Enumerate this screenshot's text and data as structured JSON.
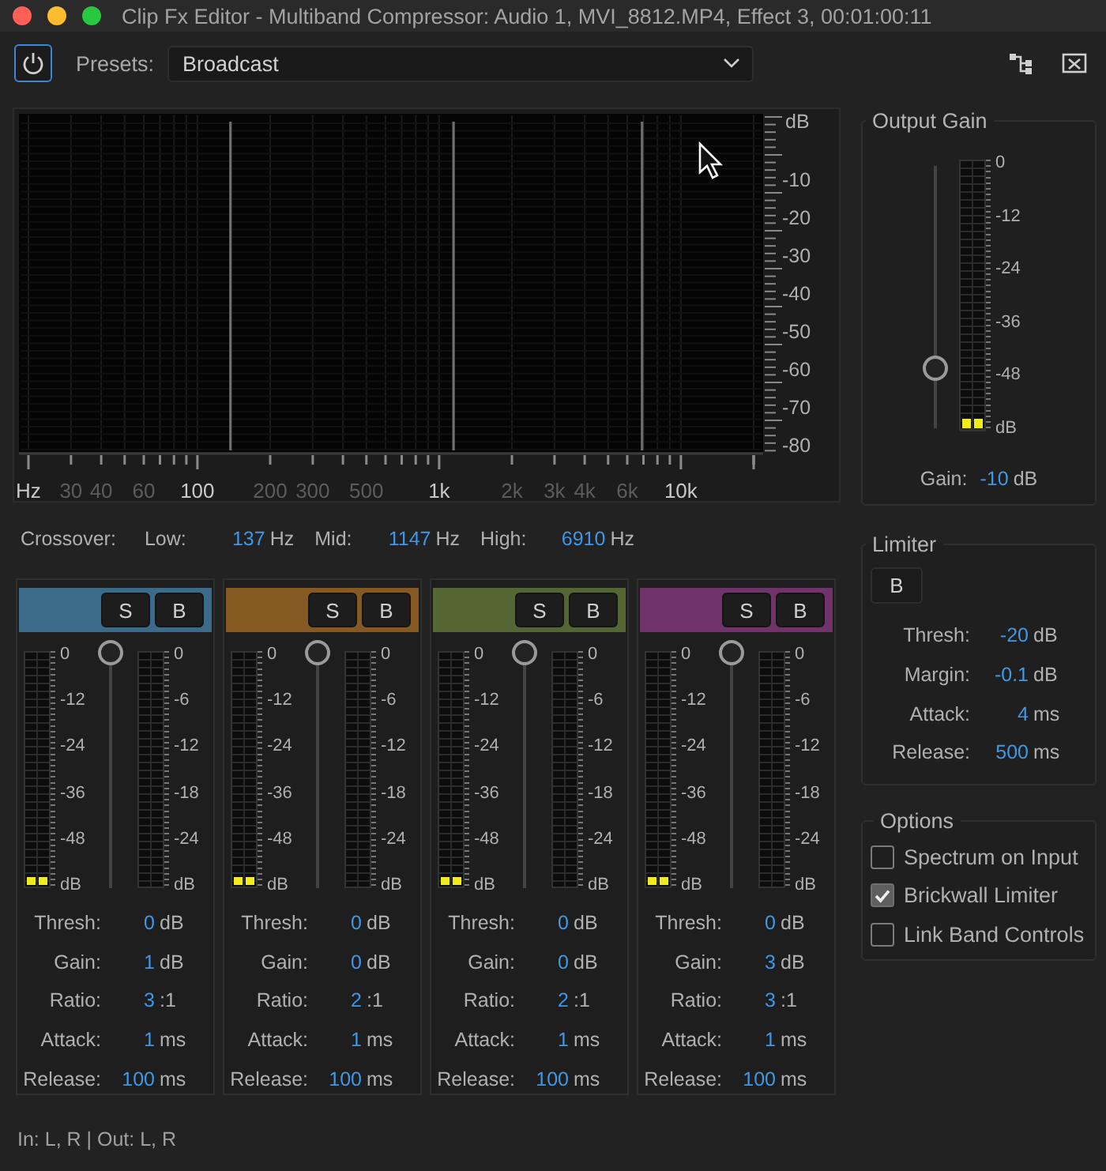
{
  "window": {
    "title": "Clip Fx Editor - Multiband Compressor: Audio 1, MVI_8812.MP4, Effect 3, 00:01:00:11"
  },
  "toolbar": {
    "power": {
      "on": true
    },
    "presets_label": "Presets:",
    "preset": "Broadcast"
  },
  "spectrum": {
    "y_unit": "dB",
    "y_labels": [
      "-10",
      "-20",
      "-30",
      "-40",
      "-50",
      "-60",
      "-70",
      "-80"
    ],
    "x_labels": [
      {
        "text": "Hz",
        "emphasized": true
      },
      {
        "text": "30",
        "emphasized": false
      },
      {
        "text": "40",
        "emphasized": false
      },
      {
        "text": "60",
        "emphasized": false
      },
      {
        "text": "100",
        "emphasized": true
      },
      {
        "text": "200",
        "emphasized": false
      },
      {
        "text": "300",
        "emphasized": false
      },
      {
        "text": "500",
        "emphasized": false
      },
      {
        "text": "1k",
        "emphasized": true
      },
      {
        "text": "2k",
        "emphasized": false
      },
      {
        "text": "3k",
        "emphasized": false
      },
      {
        "text": "4k",
        "emphasized": false
      },
      {
        "text": "6k",
        "emphasized": false
      },
      {
        "text": "10k",
        "emphasized": true
      }
    ]
  },
  "crossover": {
    "label": "Crossover:",
    "points": [
      {
        "label": "Low:",
        "value": "137",
        "unit": "Hz"
      },
      {
        "label": "Mid:",
        "value": "1147",
        "unit": "Hz"
      },
      {
        "label": "High:",
        "value": "6910",
        "unit": "Hz"
      }
    ]
  },
  "bands": [
    {
      "color": "#3b6b89",
      "solo_label": "S",
      "bypass_label": "B",
      "input_meter": {
        "labels": [
          "0",
          "-12",
          "-24",
          "-36",
          "-48",
          "dB"
        ],
        "level": 0.04
      },
      "threshold_slider": {
        "level": 1
      },
      "reduction_meter": {
        "labels": [
          "0",
          "-6",
          "-12",
          "-18",
          "-24",
          "dB"
        ]
      },
      "params": [
        {
          "label": "Thresh:",
          "value": "0",
          "unit": "dB"
        },
        {
          "label": "Gain:",
          "value": "1",
          "unit": "dB"
        },
        {
          "label": "Ratio:",
          "value": "3",
          "unit": ":1"
        },
        {
          "label": "Attack:",
          "value": "1",
          "unit": "ms"
        },
        {
          "label": "Release:",
          "value": "100",
          "unit": "ms"
        }
      ]
    },
    {
      "color": "#855a22",
      "solo_label": "S",
      "bypass_label": "B",
      "input_meter": {
        "labels": [
          "0",
          "-12",
          "-24",
          "-36",
          "-48",
          "dB"
        ],
        "level": 0.04
      },
      "threshold_slider": {
        "level": 1
      },
      "reduction_meter": {
        "labels": [
          "0",
          "-6",
          "-12",
          "-18",
          "-24",
          "dB"
        ]
      },
      "params": [
        {
          "label": "Thresh:",
          "value": "0",
          "unit": "dB"
        },
        {
          "label": "Gain:",
          "value": "0",
          "unit": "dB"
        },
        {
          "label": "Ratio:",
          "value": "2",
          "unit": ":1"
        },
        {
          "label": "Attack:",
          "value": "1",
          "unit": "ms"
        },
        {
          "label": "Release:",
          "value": "100",
          "unit": "ms"
        }
      ]
    },
    {
      "color": "#556635",
      "solo_label": "S",
      "bypass_label": "B",
      "input_meter": {
        "labels": [
          "0",
          "-12",
          "-24",
          "-36",
          "-48",
          "dB"
        ],
        "level": 0.04
      },
      "threshold_slider": {
        "level": 1
      },
      "reduction_meter": {
        "labels": [
          "0",
          "-6",
          "-12",
          "-18",
          "-24",
          "dB"
        ]
      },
      "params": [
        {
          "label": "Thresh:",
          "value": "0",
          "unit": "dB"
        },
        {
          "label": "Gain:",
          "value": "0",
          "unit": "dB"
        },
        {
          "label": "Ratio:",
          "value": "2",
          "unit": ":1"
        },
        {
          "label": "Attack:",
          "value": "1",
          "unit": "ms"
        },
        {
          "label": "Release:",
          "value": "100",
          "unit": "ms"
        }
      ]
    },
    {
      "color": "#70336c",
      "solo_label": "S",
      "bypass_label": "B",
      "input_meter": {
        "labels": [
          "0",
          "-12",
          "-24",
          "-36",
          "-48",
          "dB"
        ],
        "level": 0.04
      },
      "threshold_slider": {
        "level": 1
      },
      "reduction_meter": {
        "labels": [
          "0",
          "-6",
          "-12",
          "-18",
          "-24",
          "dB"
        ]
      },
      "params": [
        {
          "label": "Thresh:",
          "value": "0",
          "unit": "dB"
        },
        {
          "label": "Gain:",
          "value": "3",
          "unit": "dB"
        },
        {
          "label": "Ratio:",
          "value": "3",
          "unit": ":1"
        },
        {
          "label": "Attack:",
          "value": "1",
          "unit": "ms"
        },
        {
          "label": "Release:",
          "value": "100",
          "unit": "ms"
        }
      ]
    }
  ],
  "output_gain": {
    "title": "Output Gain",
    "slider": {
      "level": 0.19
    },
    "meter": {
      "labels": [
        "0",
        "-12",
        "-24",
        "-36",
        "-48",
        "dB"
      ],
      "level": 0.04
    },
    "gain": {
      "label": "Gain:",
      "value": "-10",
      "unit": "dB"
    }
  },
  "limiter": {
    "title": "Limiter",
    "bypass_label": "B",
    "params": [
      {
        "label": "Thresh:",
        "value": "-20",
        "unit": "dB"
      },
      {
        "label": "Margin:",
        "value": "-0.1",
        "unit": "dB"
      },
      {
        "label": "Attack:",
        "value": "4",
        "unit": "ms"
      },
      {
        "label": "Release:",
        "value": "500",
        "unit": "ms"
      }
    ]
  },
  "options": {
    "title": "Options",
    "items": [
      {
        "label": "Spectrum on Input",
        "checked": false
      },
      {
        "label": "Brickwall Limiter",
        "checked": true
      },
      {
        "label": "Link Band Controls",
        "checked": false
      }
    ]
  },
  "footer": {
    "io": "In: L, R | Out: L, R"
  }
}
